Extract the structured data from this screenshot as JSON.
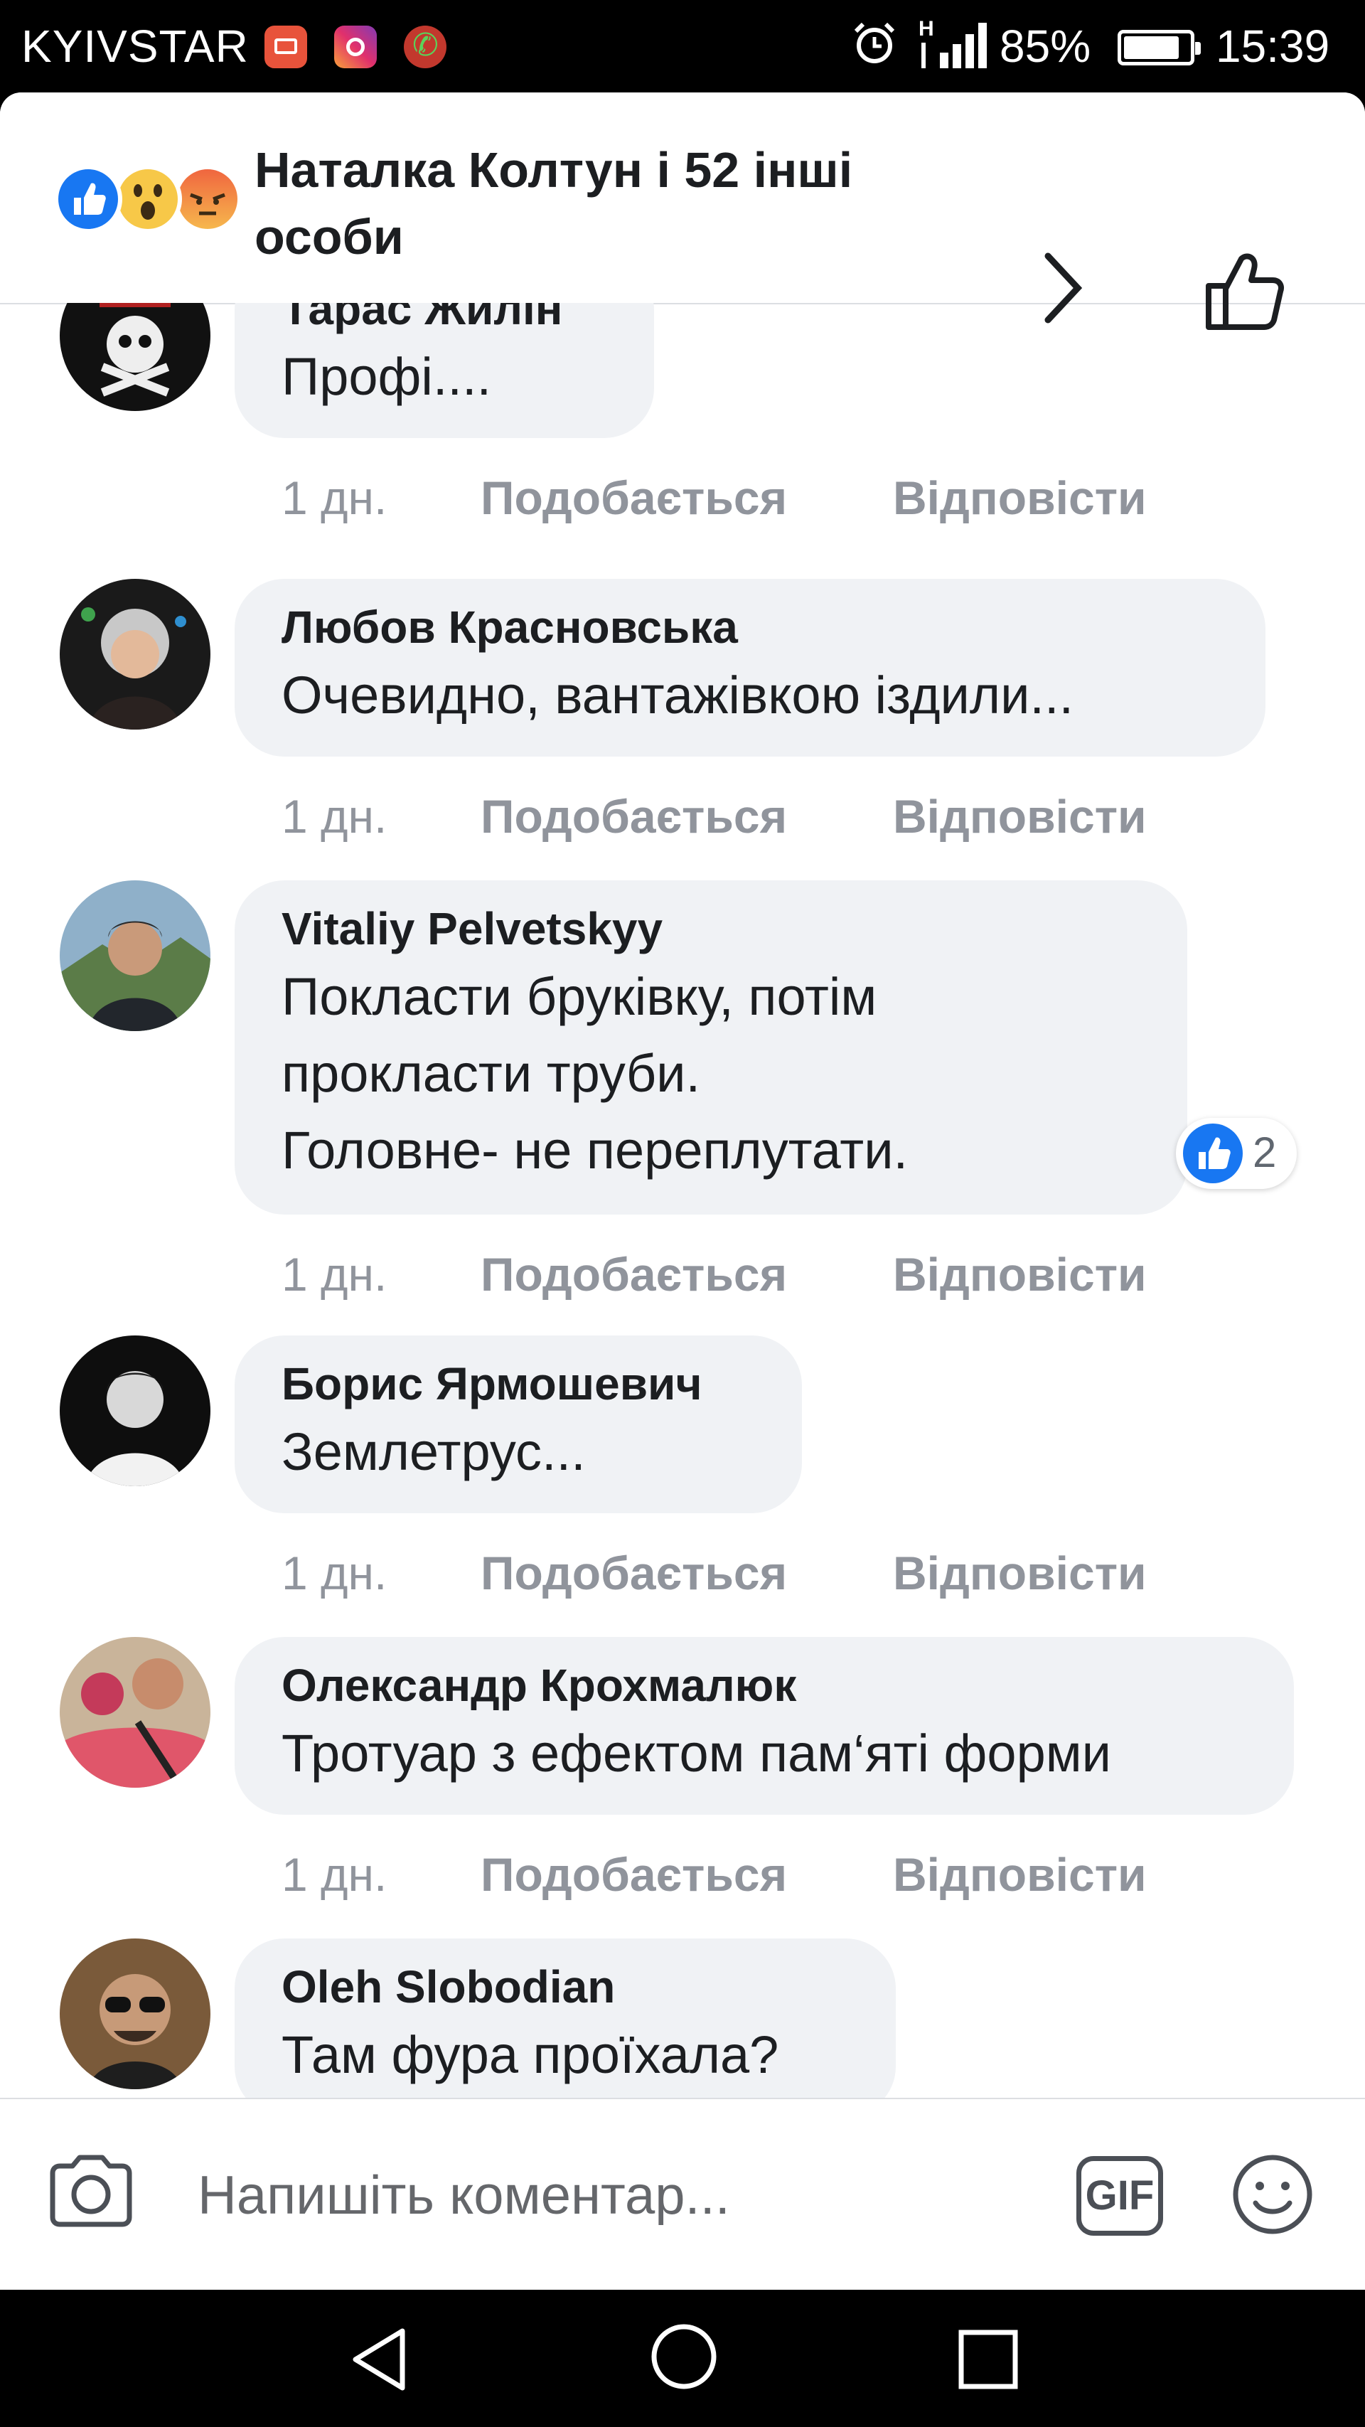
{
  "status_bar": {
    "carrier": "KYIVSTAR",
    "battery_percent": "85%",
    "battery_level": 0.85,
    "time": "15:39",
    "icons": [
      "mail-app-icon",
      "instagram-icon",
      "phone-app-icon",
      "alarm-icon",
      "signal-icon",
      "battery-icon"
    ]
  },
  "header": {
    "reaction_icons": [
      "like-reaction-icon",
      "wow-reaction-icon",
      "angry-reaction-icon"
    ],
    "title": "Наталка Колтун і 52 інші особи",
    "actions": [
      "chevron-right-icon",
      "thumbs-up-outline-icon"
    ]
  },
  "comments": [
    {
      "author": "Тарас Жилін",
      "text": "Профі....",
      "time": "1 дн.",
      "like_label": "Подобається",
      "reply_label": "Відповісти"
    },
    {
      "author": "Любов Красновська",
      "text": "Очевидно, вантажівкою іздили...",
      "time": "1 дн.",
      "like_label": "Подобається",
      "reply_label": "Відповісти"
    },
    {
      "author": "Vitaliy Pelvetskyy",
      "text_lines": [
        "Покласти бруківку, потім",
        "прокласти труби.",
        "Головне- не переплутати."
      ],
      "time": "1 дн.",
      "like_label": "Подобається",
      "reply_label": "Відповісти",
      "reaction_count": "2"
    },
    {
      "author": "Борис Ярмошевич",
      "text": "Землетрус...",
      "time": "1 дн.",
      "like_label": "Подобається",
      "reply_label": "Відповісти"
    },
    {
      "author": "Олександр Крохмалюк",
      "text": "Тротуар з ефектом пам‘яті форми",
      "time": "1 дн.",
      "like_label": "Подобається",
      "reply_label": "Відповісти"
    },
    {
      "author": "Oleh Slobodian",
      "text": "Там фура проїхала?"
    }
  ],
  "composer": {
    "placeholder": "Напишіть коментар...",
    "gif_label": "GIF",
    "icons": [
      "camera-icon",
      "gif-icon",
      "emoji-icon"
    ]
  },
  "nav_bar": {
    "icons": [
      "back-icon",
      "home-icon",
      "recents-icon"
    ]
  },
  "colors": {
    "like_blue": "#1877f2",
    "bubble_bg": "#f0f2f5",
    "meta_gray": "#90949c",
    "text": "#1c1e21"
  }
}
